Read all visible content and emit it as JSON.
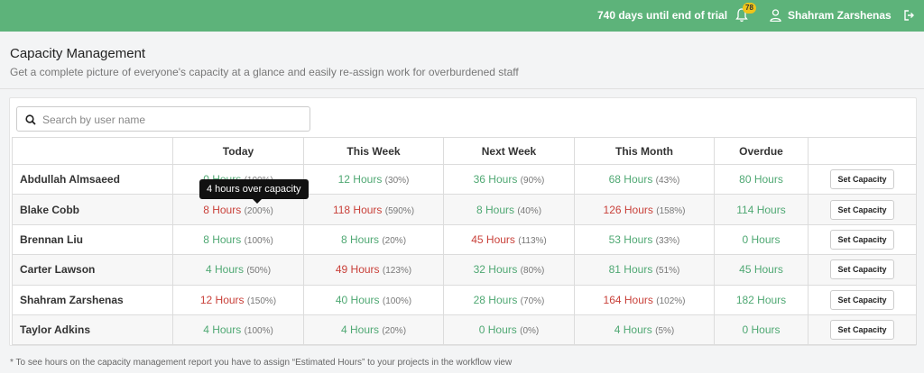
{
  "topbar": {
    "trial_text": "740 days until end of trial",
    "notification_count": "78",
    "user_name": "Shahram Zarshenas",
    "bar_color": "#5db37a"
  },
  "header": {
    "title": "Capacity Management",
    "subtitle": "Get a complete picture of everyone's capacity at a glance and easily re-assign work for overburdened staff"
  },
  "search": {
    "placeholder": "Search by user name",
    "value": ""
  },
  "table": {
    "columns": [
      "",
      "Today",
      "This Week",
      "Next Week",
      "This Month",
      "Overdue",
      ""
    ],
    "button_label": "Set Capacity",
    "rows": [
      {
        "name": "Abdullah Almsaeed",
        "today": {
          "h": "0 Hours",
          "p": "(100%)",
          "s": "ok"
        },
        "week": {
          "h": "12 Hours",
          "p": "(30%)",
          "s": "ok"
        },
        "next": {
          "h": "36 Hours",
          "p": "(90%)",
          "s": "ok"
        },
        "month": {
          "h": "68 Hours",
          "p": "(43%)",
          "s": "ok"
        },
        "overdue": {
          "h": "80 Hours",
          "s": "ok"
        }
      },
      {
        "name": "Blake Cobb",
        "today": {
          "h": "8 Hours",
          "p": "(200%)",
          "s": "over"
        },
        "week": {
          "h": "118 Hours",
          "p": "(590%)",
          "s": "over"
        },
        "next": {
          "h": "8 Hours",
          "p": "(40%)",
          "s": "ok"
        },
        "month": {
          "h": "126 Hours",
          "p": "(158%)",
          "s": "over"
        },
        "overdue": {
          "h": "114 Hours",
          "s": "ok"
        }
      },
      {
        "name": "Brennan Liu",
        "today": {
          "h": "8 Hours",
          "p": "(100%)",
          "s": "ok"
        },
        "week": {
          "h": "8 Hours",
          "p": "(20%)",
          "s": "ok"
        },
        "next": {
          "h": "45 Hours",
          "p": "(113%)",
          "s": "over"
        },
        "month": {
          "h": "53 Hours",
          "p": "(33%)",
          "s": "ok"
        },
        "overdue": {
          "h": "0 Hours",
          "s": "ok"
        }
      },
      {
        "name": "Carter Lawson",
        "today": {
          "h": "4 Hours",
          "p": "(50%)",
          "s": "ok"
        },
        "week": {
          "h": "49 Hours",
          "p": "(123%)",
          "s": "over"
        },
        "next": {
          "h": "32 Hours",
          "p": "(80%)",
          "s": "ok"
        },
        "month": {
          "h": "81 Hours",
          "p": "(51%)",
          "s": "ok"
        },
        "overdue": {
          "h": "45 Hours",
          "s": "ok"
        }
      },
      {
        "name": "Shahram Zarshenas",
        "today": {
          "h": "12 Hours",
          "p": "(150%)",
          "s": "over"
        },
        "week": {
          "h": "40 Hours",
          "p": "(100%)",
          "s": "ok"
        },
        "next": {
          "h": "28 Hours",
          "p": "(70%)",
          "s": "ok"
        },
        "month": {
          "h": "164 Hours",
          "p": "(102%)",
          "s": "over"
        },
        "overdue": {
          "h": "182 Hours",
          "s": "ok"
        }
      },
      {
        "name": "Taylor Adkins",
        "today": {
          "h": "4 Hours",
          "p": "(100%)",
          "s": "ok"
        },
        "week": {
          "h": "4 Hours",
          "p": "(20%)",
          "s": "ok"
        },
        "next": {
          "h": "0 Hours",
          "p": "(0%)",
          "s": "ok"
        },
        "month": {
          "h": "4 Hours",
          "p": "(5%)",
          "s": "ok"
        },
        "overdue": {
          "h": "0 Hours",
          "s": "ok"
        }
      }
    ]
  },
  "tooltip": {
    "text": "4 hours over capacity"
  },
  "footnote": "* To see hours on the capacity management report you have to assign “Estimated Hours” to your projects in the workflow view"
}
